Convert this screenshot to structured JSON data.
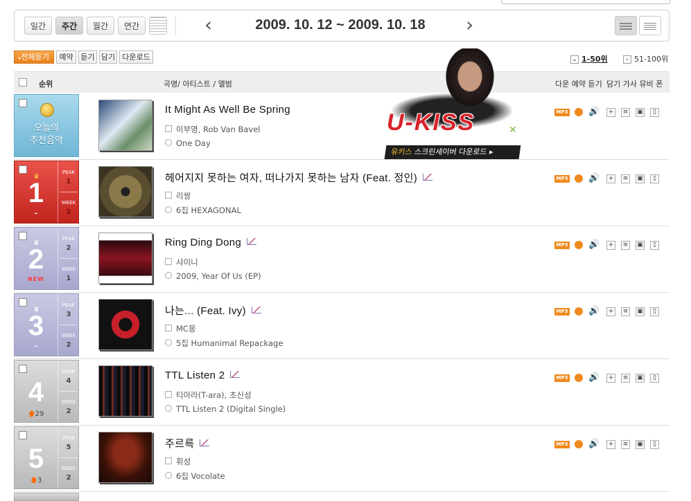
{
  "period_tabs": [
    "일간",
    "주간",
    "월간",
    "연간"
  ],
  "active_period": "주간",
  "period_title": "2009. 10. 12 ~ 2009. 10. 18",
  "actions": {
    "play_all": "전체듣기",
    "reserve": "예약",
    "listen": "듣기",
    "add": "담기",
    "download": "다운로드"
  },
  "range": {
    "current": "1-50위",
    "next": "51-100위"
  },
  "table_header": {
    "rank": "순위",
    "song_info": "곡명/ 아티스트 / 앨범",
    "actions_left": "다운 예약 듣기",
    "actions_right": "담기 가사 뮤비 폰"
  },
  "promo": {
    "logo": "U-KISS",
    "banner_highlight": "유키스",
    "banner_text": "스크린세이버 다운로드"
  },
  "recommended": {
    "label_line1": "오늘의",
    "label_line2": "추천음악",
    "title": "It Might As Well Be Spring",
    "artist": "이부영, Rob Van Bavel",
    "album": "One Day"
  },
  "chart_labels": {
    "peak": "PEAK",
    "week": "WEEK"
  },
  "songs": [
    {
      "rank": "1",
      "change": "–",
      "peak": "1",
      "week": "2",
      "title": "헤어지지 못하는 여자, 떠나가지 못하는 남자 (Feat. 정인)",
      "artist": "리쌍",
      "album": "6집 HEXAGONAL"
    },
    {
      "rank": "2",
      "change": "NEW",
      "peak": "2",
      "week": "1",
      "title": "Ring Ding Dong",
      "artist": "샤이니",
      "album": "2009, Year Of Us (EP)"
    },
    {
      "rank": "3",
      "change": "–",
      "peak": "3",
      "week": "2",
      "title": "나는... (Feat. Ivy)",
      "artist": "MC몽",
      "album": "5집 Humanimal Repackage"
    },
    {
      "rank": "4",
      "change": "29",
      "peak": "4",
      "week": "2",
      "title": "TTL Listen 2",
      "artist": "티아라(T-ara), 초신성",
      "album": "TTL Listen 2 (Digital Single)"
    },
    {
      "rank": "5",
      "change": "3",
      "peak": "5",
      "week": "2",
      "title": "주르륵",
      "artist": "휘성",
      "album": "6집 Vocolate"
    }
  ],
  "colors": {
    "accent": "#f08a1f",
    "rank1": "#d33a33",
    "rank_new": "#b0b0d4",
    "rank_gray": "#c8c8c8",
    "recommend": "#86c3e0"
  },
  "icons": {
    "mp3": "MP3",
    "reserve": "clock-icon",
    "listen": "speaker-icon",
    "add": "plus-icon",
    "lyrics": "lyrics-icon",
    "mv": "tv-icon",
    "phone": "phone-icon"
  }
}
